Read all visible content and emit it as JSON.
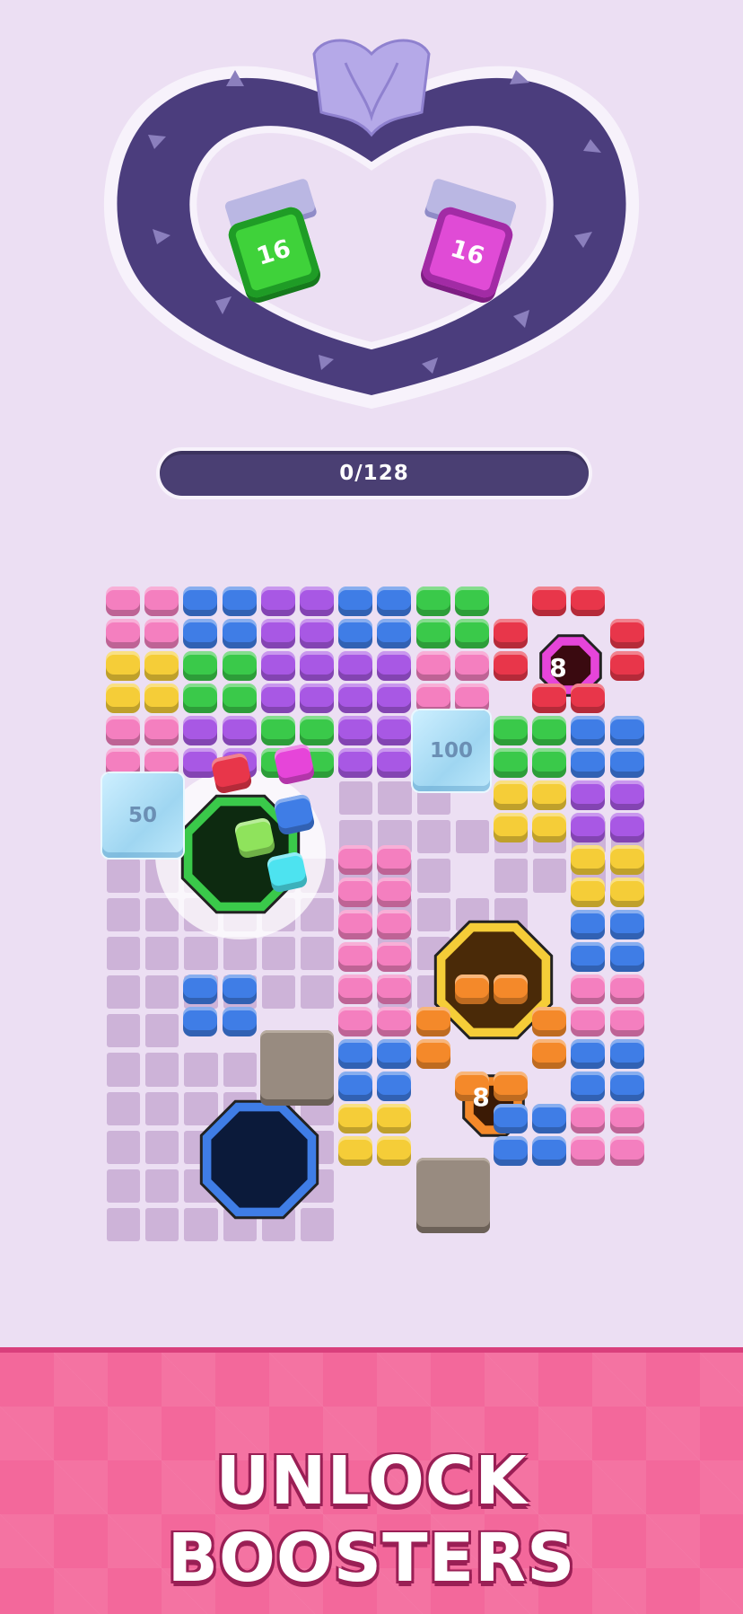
{
  "progress": {
    "label": "0/128",
    "fraction": 0
  },
  "containers": [
    {
      "label": "16",
      "color": "#3fd23a"
    },
    {
      "label": "16",
      "color": "#e04bd6"
    }
  ],
  "board": {
    "ice_blocks": [
      "50",
      "100"
    ],
    "lock_badges": [
      "8",
      "8"
    ]
  },
  "banner": {
    "text": "UNLOCK BOOSTERS"
  },
  "palette": {
    "pink": "#f47fbf",
    "blue": "#3f7de6",
    "purple": "#a858e4",
    "green": "#3ac94a",
    "red": "#e8364a",
    "yellow": "#f5cd38",
    "orange": "#f4892a",
    "magenta": "#e645d9",
    "lime": "#8fe35c",
    "cyan": "#4de3f0"
  }
}
